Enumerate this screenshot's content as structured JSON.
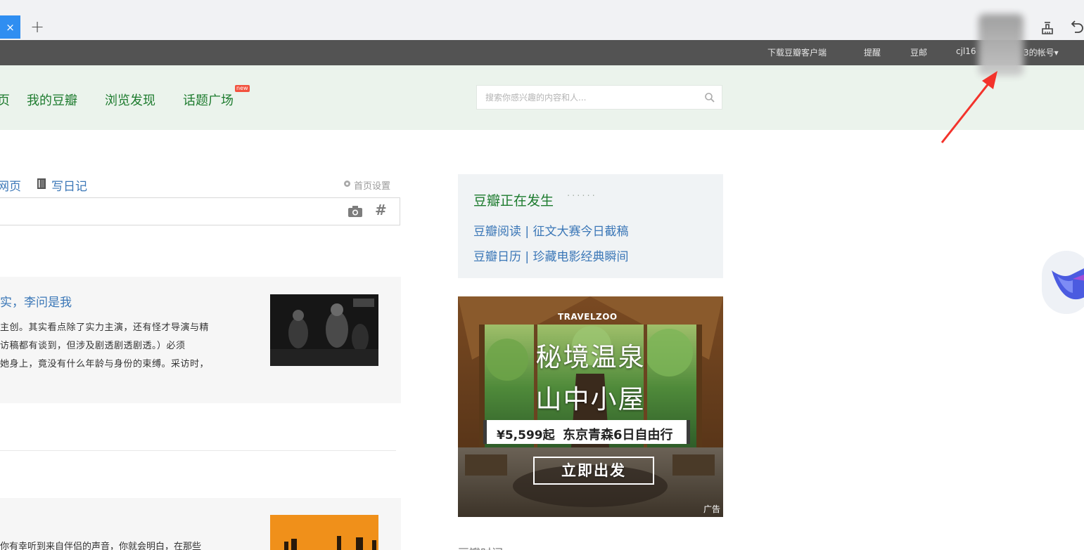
{
  "browser": {
    "tab_close": "×",
    "new_tab": "+"
  },
  "topbar": {
    "download_client": "下载豆瓣客户端",
    "reminder": "提醒",
    "mail": "豆邮",
    "account_prefix": "cjl16",
    "account_suffix": "3的帐号▾"
  },
  "nav": {
    "items": [
      "页",
      "我的豆瓣",
      "浏览发现",
      "话题广场"
    ],
    "new_badge": "new",
    "search_placeholder": "搜索你感兴趣的内容和人..."
  },
  "post": {
    "web_link": "网页",
    "diary_link": "写日记",
    "settings": "首页设置",
    "hash": "#"
  },
  "feed": {
    "item1": {
      "title": "实，李问是我",
      "lines": [
        "主创。其实看点除了实力主演，还有怪才导演与精",
        "访稿都有谈到，但涉及剧透剧透剧透。）必须",
        "她身上，竟没有什么年龄与身份的束缚。采访时，"
      ]
    },
    "item2": {
      "line": "你有幸听到来自伴侣的声音，你就会明白，在那些"
    }
  },
  "happening": {
    "title": "豆瓣正在发生",
    "dots": "······",
    "links": [
      "豆瓣阅读 | 征文大赛今日截稿",
      "豆瓣日历 | 珍藏电影经典瞬间"
    ]
  },
  "ad": {
    "brand": "TRAVELZOO",
    "headline1": "秘境温泉",
    "headline2": "山中小屋",
    "price": "¥5,599起",
    "destination": "东京青森6日自由行",
    "cta": "立即出发",
    "tag": "广告"
  },
  "bottom": {
    "partial": "豆瓣时间"
  },
  "colors": {
    "douban_green": "#1d7b2e",
    "link_blue": "#3b77b7",
    "topbar_bg": "#535353",
    "nav_bg": "#ebf3ec",
    "tab_blue": "#2f8ef1",
    "arrow_red": "#f3322b"
  }
}
